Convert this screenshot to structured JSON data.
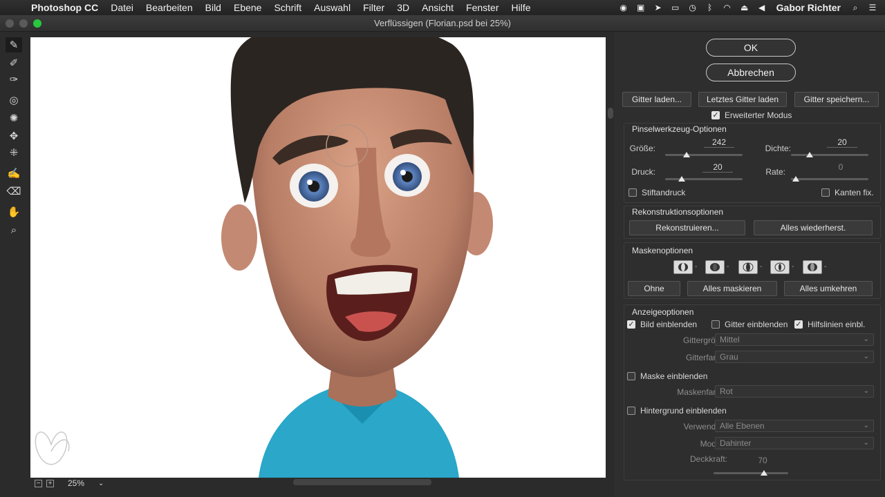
{
  "menubar": {
    "app_name": "Photoshop CC",
    "items": [
      "Datei",
      "Bearbeiten",
      "Bild",
      "Ebene",
      "Schrift",
      "Auswahl",
      "Filter",
      "3D",
      "Ansicht",
      "Fenster",
      "Hilfe"
    ],
    "user": "Gabor Richter"
  },
  "window": {
    "title": "Verflüssigen (Florian.psd bei 25%)"
  },
  "statusbar": {
    "zoom": "25%",
    "zoom_out": "−",
    "zoom_in": "+"
  },
  "panel": {
    "ok": "OK",
    "cancel": "Abbrechen",
    "mesh": {
      "load": "Gitter laden...",
      "load_last": "Letztes Gitter laden",
      "save": "Gitter speichern..."
    },
    "advanced_mode": {
      "label": "Erweiterter Modus",
      "checked": true
    },
    "brush": {
      "title": "Pinselwerkzeug-Optionen",
      "size_label": "Größe:",
      "size_value": "242",
      "density_label": "Dichte:",
      "density_value": "20",
      "pressure_label": "Druck:",
      "pressure_value": "20",
      "rate_label": "Rate:",
      "rate_value": "0",
      "stylus_label": "Stiftandruck",
      "pin_edges_label": "Kanten fix."
    },
    "reconstruct": {
      "title": "Rekonstruktionsoptionen",
      "reconstruct": "Rekonstruieren...",
      "restore_all": "Alles wiederherst."
    },
    "mask": {
      "title": "Maskenoptionen",
      "none": "Ohne",
      "mask_all": "Alles maskieren",
      "invert_all": "Alles umkehren"
    },
    "view": {
      "title": "Anzeigeoptionen",
      "show_image": "Bild einblenden",
      "show_mesh": "Gitter einblenden",
      "show_guides": "Hilfslinien einbl.",
      "mesh_size_label": "Gittergröße:",
      "mesh_size_value": "Mittel",
      "mesh_color_label": "Gitterfarbe:",
      "mesh_color_value": "Grau",
      "show_mask": "Maske einblenden",
      "mask_color_label": "Maskenfarbe:",
      "mask_color_value": "Rot",
      "show_backdrop": "Hintergrund einblenden",
      "use_label": "Verwenden:",
      "use_value": "Alle Ebenen",
      "mode_label": "Modus:",
      "mode_value": "Dahinter",
      "opacity_label": "Deckkraft:",
      "opacity_value": "70"
    }
  },
  "colors": {
    "panel_bg": "#2e2e2e",
    "canvas_bg": "#ffffff",
    "shirt": "#2aa7c9",
    "skin": "#c88e74",
    "hair": "#2b2521",
    "iris": "#4a6fa8"
  },
  "tools": [
    "forward-warp-icon",
    "reconstruct-icon",
    "smooth-icon",
    "twirl-icon",
    "pucker-icon",
    "bloat-icon",
    "push-left-icon",
    "freeze-mask-icon",
    "thaw-mask-icon",
    "hand-icon",
    "zoom-icon"
  ]
}
